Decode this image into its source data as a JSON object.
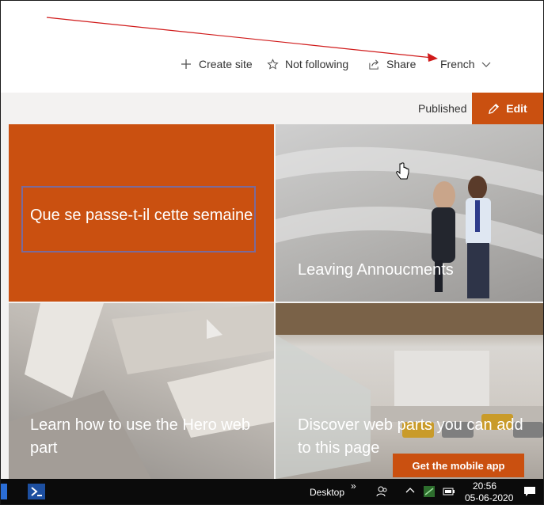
{
  "command_bar": {
    "create_site": "Create site",
    "not_following": "Not following",
    "share": "Share",
    "language": "French"
  },
  "page_status": {
    "published": "Published",
    "edit": "Edit"
  },
  "hero": {
    "tiles": [
      {
        "title": "Que se passe-t-il cette semaine"
      },
      {
        "title": "Leaving Annoucments"
      },
      {
        "title": "Learn how to use the Hero web part"
      },
      {
        "title": "Discover web parts you can add to this page"
      }
    ]
  },
  "mobile_app_button": "Get the mobile app",
  "taskbar": {
    "desktop_label": "Desktop",
    "overflow": "»",
    "time": "20:56",
    "date": "05-06-2020"
  },
  "colors": {
    "accent": "#ca5010",
    "annotation_arrow": "#d01a1a"
  },
  "icons": [
    "plus-icon",
    "star-icon",
    "share-icon",
    "chevron-down-icon",
    "pencil-icon",
    "cursor-hand-icon",
    "powershell-icon",
    "people-icon",
    "chevron-up-icon",
    "network-icon",
    "battery-icon",
    "notification-icon"
  ]
}
